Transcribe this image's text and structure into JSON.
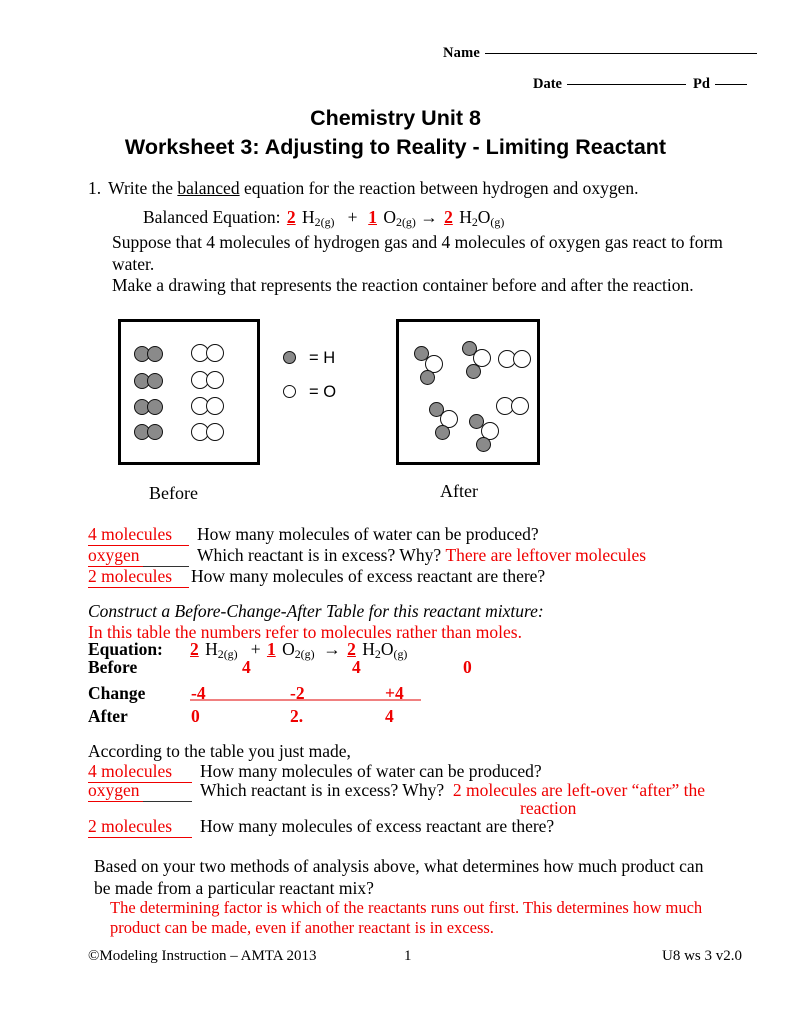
{
  "header": {
    "name_label": "Name",
    "date_label": "Date",
    "pd_label": "Pd"
  },
  "title": {
    "line1": "Chemistry Unit 8",
    "line2": "Worksheet 3:  Adjusting to Reality - Limiting Reactant"
  },
  "question1": {
    "number": "1.",
    "text_before": "Write the ",
    "underlined": "balanced",
    "text_after": " equation for the reaction between hydrogen and oxygen.",
    "balanced_label": "Balanced Equation:",
    "coef_h2": "2",
    "coef_o2": "1",
    "coef_h2o": "2",
    "plus": "+",
    "arrow": "→",
    "suppose": "Suppose that 4 molecules of hydrogen gas and 4 molecules of oxygen gas react to form water.",
    "make_drawing": "Make a drawing that represents the reaction container before and after the reaction."
  },
  "legend": {
    "h_label": "= H",
    "o_label": "= O"
  },
  "diagram": {
    "before_label": "Before",
    "after_label": "After",
    "before": {
      "hydrogen_pairs": 4,
      "oxygen_pairs": 4
    },
    "after": {
      "water_molecules": 4,
      "leftover_oxygen_pairs": 2
    }
  },
  "answers_diagram": [
    {
      "blank": "4 molecules",
      "question": "How many molecules of water can be produced?",
      "extra": ""
    },
    {
      "blank": "oxygen",
      "question": "Which reactant is in excess?  Why?",
      "extra": "There are leftover molecules"
    },
    {
      "blank": "2 molecules",
      "question": "How many molecules of excess reactant are there?",
      "extra": ""
    }
  ],
  "bca": {
    "instruction": "Construct a Before-Change-After Table for this reactant mixture:",
    "note": "In this table the numbers refer to molecules rather than moles.",
    "row_labels": {
      "equation": "Equation:",
      "before": "Before",
      "change": "Change",
      "after": "After"
    },
    "equation_coefficients": {
      "h2": "2",
      "o2": "1",
      "h2o": "2"
    },
    "columns": [
      "H2(g)",
      "O2(g)",
      "H2O(g)"
    ],
    "before_values": [
      "4",
      "4",
      "0"
    ],
    "change_values": [
      "-4",
      "-2",
      "+4"
    ],
    "after_values": [
      "0",
      "2.",
      "4"
    ]
  },
  "answers_table": {
    "intro": "According to the table you just made,",
    "rows": [
      {
        "blank": "4 molecules",
        "question": "How many molecules of water can be produced?",
        "extra": ""
      },
      {
        "blank": "oxygen",
        "question": "Which reactant is in excess?  Why?",
        "extra": "2 molecules are left-over “after” the",
        "extra_line2": "reaction"
      },
      {
        "blank": "2 molecules",
        "question": "How many molecules of excess reactant are there?",
        "extra": ""
      }
    ]
  },
  "final": {
    "question": "Based on your two methods of analysis above, what determines how much product can be made from a particular reactant mix?",
    "answer": "The determining factor is which of the reactants runs out first.  This determines how much product can be made, even if another reactant is in excess."
  },
  "footer": {
    "left": "©Modeling Instruction – AMTA 2013",
    "center": "1",
    "right": "U8 ws 3 v2.0"
  },
  "colors": {
    "answer_red": "#ef0000",
    "change_rule": "#f08080",
    "hydrogen_fill": "#8a8a8a",
    "oxygen_fill": "#ffffff"
  }
}
